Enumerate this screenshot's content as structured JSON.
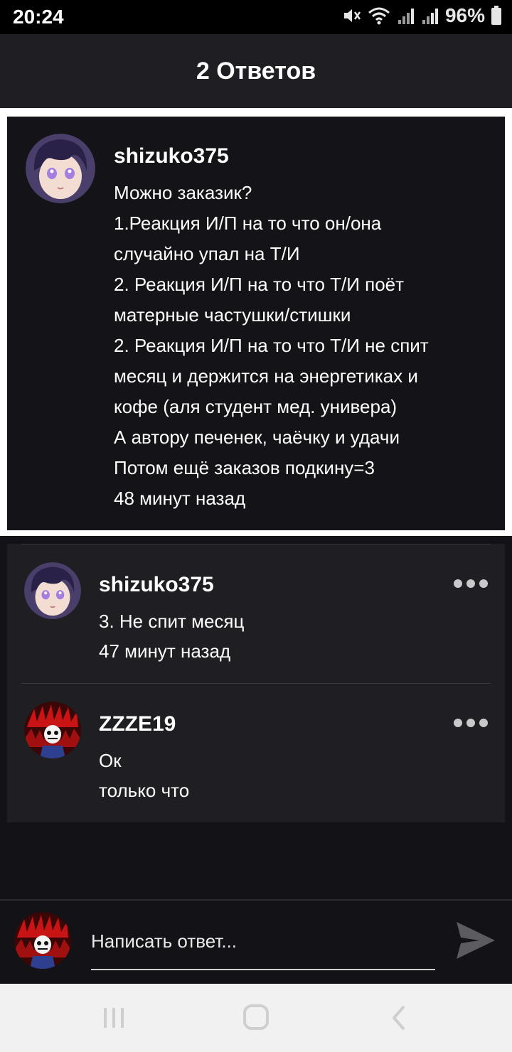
{
  "status_bar": {
    "time": "20:24",
    "battery": "96%",
    "icons": [
      "mute-icon",
      "wifi-icon",
      "signal-icon",
      "signal-icon",
      "battery-icon"
    ]
  },
  "header": {
    "title": "2 Ответов"
  },
  "original_post": {
    "username": "shizuko375",
    "lines": [
      "Можно заказик?",
      "1.Реакция И/П на то что он/она",
      "случайно упал на Т/И",
      "2. Реакция И/П на то что Т/И поёт",
      "матерные частушки/стишки",
      "2. Реакция И/П на то что Т/И не спит",
      "месяц и держится на энергетиках и",
      "кофе (аля студент мед. универа)",
      "А автору печенек, чаёчку и удачи",
      "Потом ещё заказов подкину=3"
    ],
    "time": "48 минут назад"
  },
  "replies": [
    {
      "username": "shizuko375",
      "text": "3. Не спит месяц",
      "time": "47 минут назад"
    },
    {
      "username": "ZZZE19",
      "text": "Ок",
      "time": "только что"
    }
  ],
  "composer": {
    "placeholder": "Написать ответ..."
  },
  "colors": {
    "background": "#131216",
    "panel": "#1f1e22",
    "header": "#1f1e22",
    "text": "#ffffff"
  }
}
